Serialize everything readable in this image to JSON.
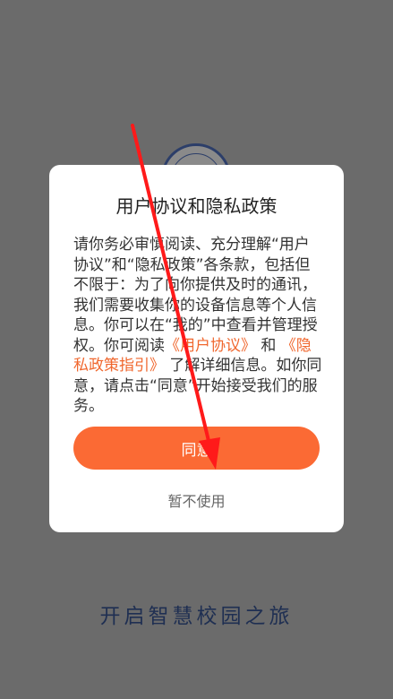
{
  "dialog": {
    "title": "用户协议和隐私政策",
    "body_part1": "请你务必审慎阅读、充分理解“用户协议”和“隐私政策”各条款，包括但不限于：为了向你提供及时的通讯，我们需要收集你的设备信息等个人信息。你可以在“我的”中查看并管理授权。你可阅读",
    "user_agreement_link": "《用户协议》",
    "and_text": "和",
    "privacy_link": "《隐私政策指引》",
    "body_part2": "了解详细信息。如你同意，请点击“同意”开始接受我们的服务。",
    "agree_label": "同意",
    "decline_label": "暂不使用"
  },
  "slogan": "开启智慧校园之旅",
  "colors": {
    "accent": "#fb6a34",
    "link": "#f0672e",
    "annotation_arrow": "#ff1a1a"
  },
  "icons": [
    "school-logo-icon",
    "annotation-arrow-icon"
  ]
}
